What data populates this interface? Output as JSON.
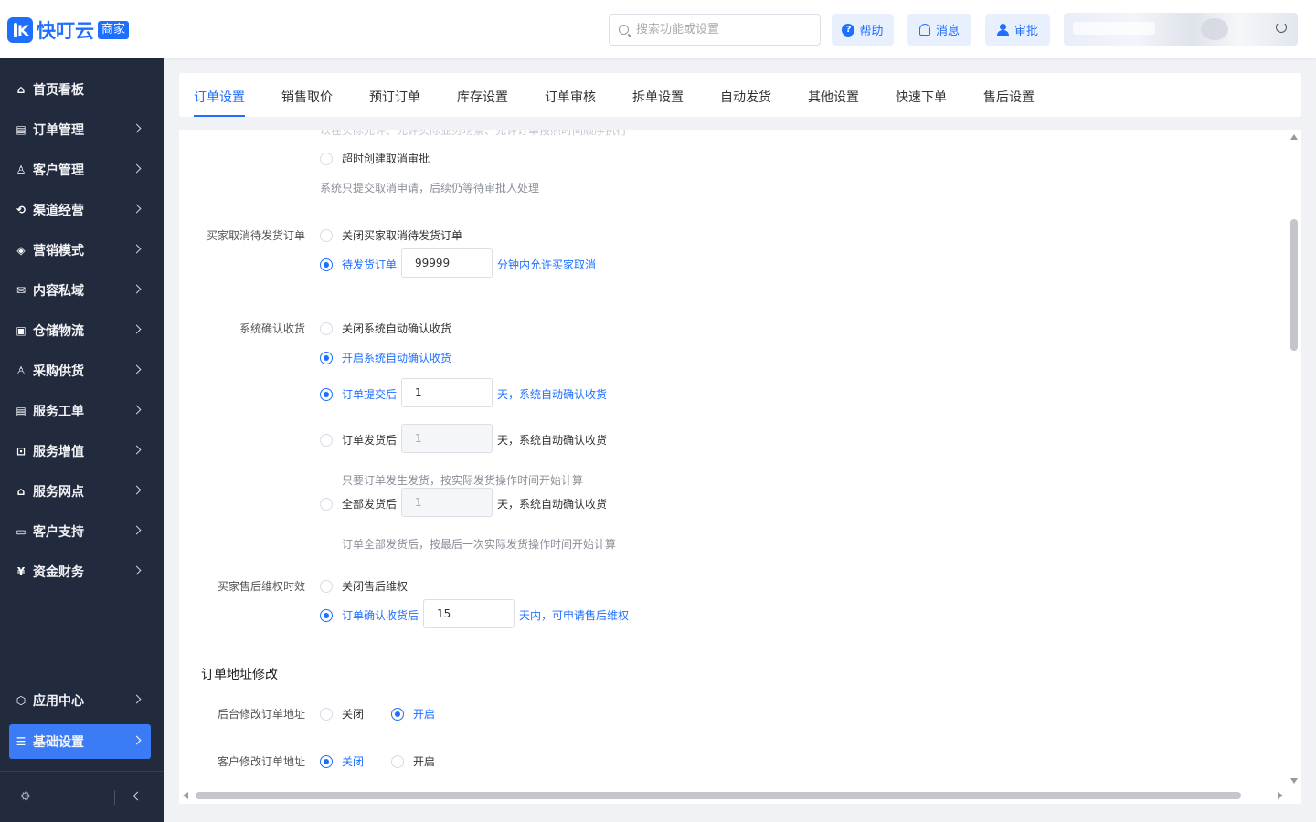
{
  "brand": {
    "name": "快叮云",
    "badge": "商家",
    "logo_letter": "K",
    "accent": "#1f6fff"
  },
  "header": {
    "search_placeholder": "搜索功能或设置",
    "help_label": "帮助",
    "message_label": "消息",
    "approval_label": "审批"
  },
  "sidebar": {
    "items": [
      {
        "label": "首页看板",
        "icon": "home-icon"
      },
      {
        "label": "订单管理",
        "icon": "order-icon"
      },
      {
        "label": "客户管理",
        "icon": "user-icon"
      },
      {
        "label": "渠道经营",
        "icon": "channel-icon"
      },
      {
        "label": "营销模式",
        "icon": "tag-icon"
      },
      {
        "label": "内容私域",
        "icon": "mail-icon"
      },
      {
        "label": "仓储物流",
        "icon": "box-icon"
      },
      {
        "label": "采购供货",
        "icon": "purchase-icon"
      },
      {
        "label": "服务工单",
        "icon": "ticket-icon"
      },
      {
        "label": "服务增值",
        "icon": "gift-icon"
      },
      {
        "label": "服务网点",
        "icon": "store-icon"
      },
      {
        "label": "客户支持",
        "icon": "support-icon"
      },
      {
        "label": "资金财务",
        "icon": "finance-icon"
      }
    ],
    "app_center": "应用中心",
    "basic_settings": "基础设置"
  },
  "tabs": [
    "订单设置",
    "销售取价",
    "预订订单",
    "库存设置",
    "订单审核",
    "拆单设置",
    "自动发货",
    "其他设置",
    "快速下单",
    "售后设置"
  ],
  "content": {
    "top_faded": "以在实际允许、允许实际业务场景、允许订单按照时间顺序执行",
    "timeout_cancel_option": "超时创建取消审批",
    "timeout_cancel_hint": "系统只提交取消申请，后续仍等待审批人处理",
    "buyer_cancel": {
      "label": "买家取消待发货订单",
      "opt_close": "关闭买家取消待发货订单",
      "opt_pending": "待发货订单",
      "minutes": "99999",
      "suffix": "分钟内允许买家取消"
    },
    "auto_confirm": {
      "label": "系统确认收货",
      "opt_close": "关闭系统自动确认收货",
      "opt_open": "开启系统自动确认收货",
      "after_submit": "订单提交后",
      "after_submit_days": "1",
      "after_submit_suffix": "天，系统自动确认收货",
      "after_ship": "订单发货后",
      "after_ship_days": "1",
      "after_ship_suffix": "天，系统自动确认收货",
      "after_ship_hint": "只要订单发生发货，按实际发货操作时间开始计算",
      "all_shipped": "全部发货后",
      "all_shipped_days": "1",
      "all_shipped_suffix": "天，系统自动确认收货",
      "all_shipped_hint": "订单全部发货后，按最后一次实际发货操作时间开始计算"
    },
    "after_sale": {
      "label": "买家售后维权时效",
      "opt_close": "关闭售后维权",
      "opt_open": "订单确认收货后",
      "days": "15",
      "suffix": "天内，可申请售后维权"
    },
    "address_section_title": "订单地址修改",
    "backend_address": {
      "label": "后台修改订单地址",
      "off": "关闭",
      "on": "开启"
    },
    "customer_address": {
      "label": "客户修改订单地址",
      "off": "关闭",
      "on": "开启"
    }
  }
}
